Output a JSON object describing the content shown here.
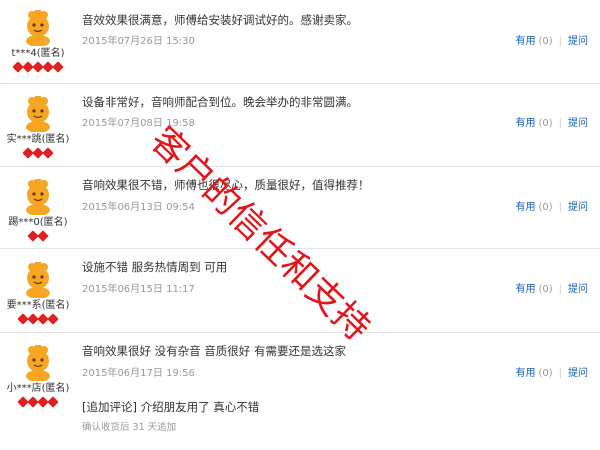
{
  "reviews": [
    {
      "username": "t***4(匿名)",
      "comment": "音效效果很满意，师傅给安装好调试好的。感谢卖家。",
      "date": "2015年07月26日 15:30",
      "useful_label": "有用",
      "useful_count": "(0)",
      "ask_label": "提问",
      "gems": 5
    },
    {
      "username": "实***跳(匿名)",
      "comment": "设备非常好，音响师配合到位。晚会举办的非常圆满。",
      "date": "2015年07月08日 19:58",
      "useful_label": "有用",
      "useful_count": "(0)",
      "ask_label": "提问",
      "gems": 3
    },
    {
      "username": "踢***0(匿名)",
      "comment": "音响效果很不错，师傅也很尽心，质量很好，值得推荐！",
      "date": "2015年06月13日 09:54",
      "useful_label": "有用",
      "useful_count": "(0)",
      "ask_label": "提问",
      "gems": 2
    },
    {
      "username": "要***系(匿名)",
      "comment": "设施不错 服务热情周到 可用",
      "date": "2015年06月15日 11:17",
      "useful_label": "有用",
      "useful_count": "(0)",
      "ask_label": "提问",
      "gems": 4
    },
    {
      "username": "小***店(匿名)",
      "comment": "音响效果很好 没有杂音 音质很好 有需要还是选这家",
      "date": "2015年06月17日 19:56",
      "useful_label": "有用",
      "useful_count": "(0)",
      "ask_label": "提问",
      "gems": 4,
      "append_comment": "[追加评论] 介绍朋友用了 真心不错",
      "append_note": "确认收货后 31 天追加"
    }
  ],
  "watermark": "客户的信任和支持",
  "colors": {
    "link": "#1a5fb4",
    "watermark": "#e0161b",
    "gem": "#e02020",
    "muted": "#999999"
  }
}
